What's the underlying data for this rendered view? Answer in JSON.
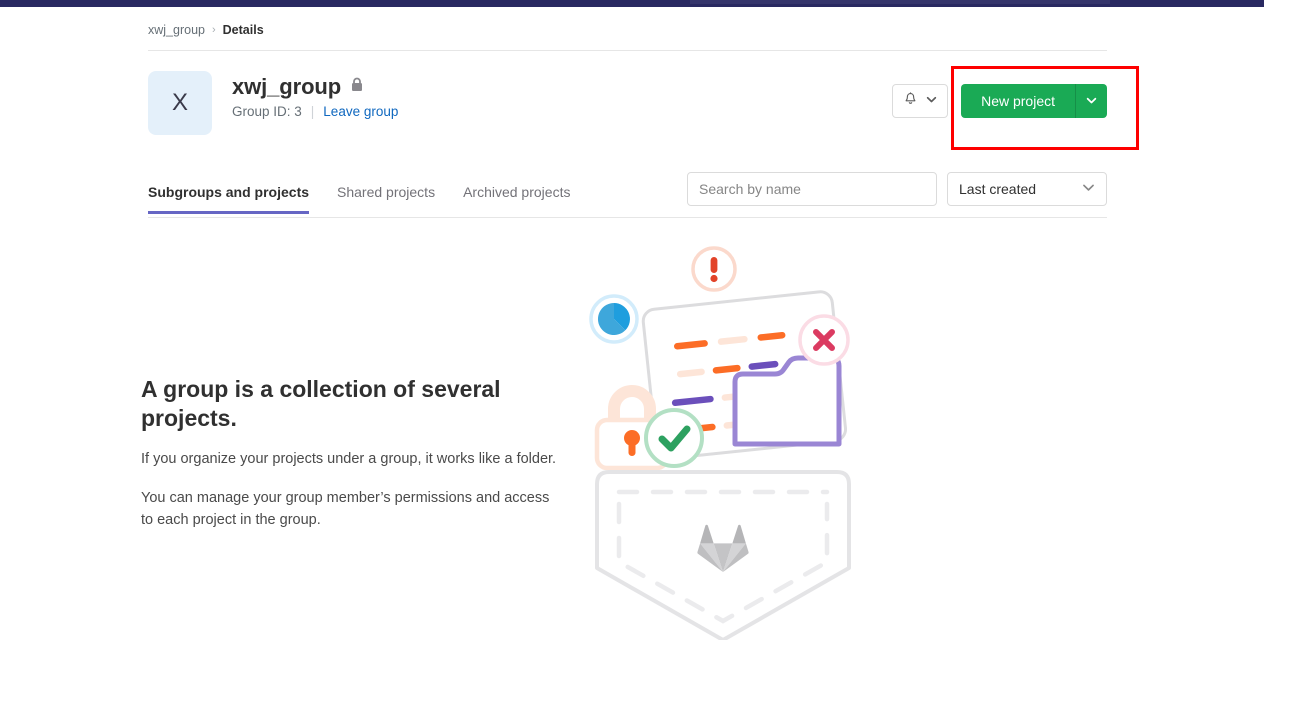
{
  "topbar": {
    "color": "#292961"
  },
  "breadcrumb": {
    "group": "xwj_group",
    "separator": "›",
    "current": "Details"
  },
  "group_header": {
    "avatar_letter": "X",
    "name": "xwj_group",
    "visibility_icon": "lock-icon",
    "group_id_label": "Group ID: 3",
    "leave_label": "Leave group"
  },
  "actions": {
    "notification_icon": "bell-icon",
    "notification_caret_icon": "chevron-down-icon",
    "new_project_label": "New project",
    "new_project_caret_icon": "chevron-down-icon",
    "new_project_color": "#1aaa55",
    "highlight_color": "#fe0000"
  },
  "tabs": [
    {
      "label": "Subgroups and projects",
      "active": true
    },
    {
      "label": "Shared projects",
      "active": false
    },
    {
      "label": "Archived projects",
      "active": false
    }
  ],
  "tab_underline_color": "#6666c4",
  "filters": {
    "search_placeholder": "Search by name",
    "search_value": "",
    "sort_value": "Last created",
    "sort_caret_icon": "chevron-down-icon"
  },
  "empty_state": {
    "title": "A group is a collection of several projects.",
    "paragraph1": "If you organize your projects under a group, it works like a folder.",
    "paragraph2": "You can manage your group member’s permissions and access to each project in the group.",
    "illustration": {
      "name": "empty-group-pocket-illustration",
      "elements": [
        "exclamation-circle-icon",
        "pie-chart-circle-icon",
        "x-circle-icon",
        "padlock-icon",
        "check-circle-icon",
        "document-card",
        "folder-icon",
        "pocket-shape",
        "gitlab-tanuki-logo"
      ]
    }
  }
}
